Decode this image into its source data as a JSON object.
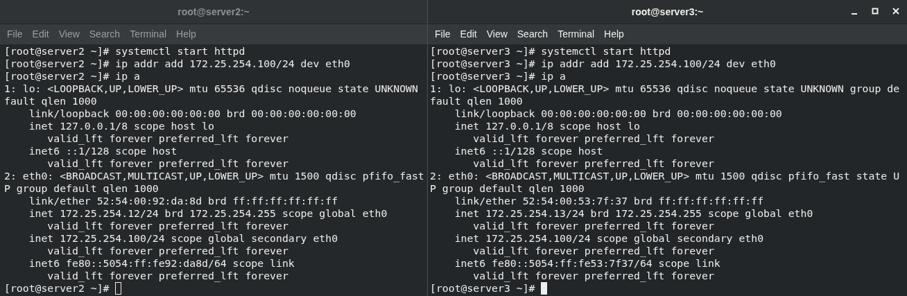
{
  "windows": [
    {
      "title": "root@server2:~",
      "active": false,
      "menu": [
        "File",
        "Edit",
        "View",
        "Search",
        "Terminal",
        "Help"
      ],
      "lines": [
        "[root@server2 ~]# systemctl start httpd",
        "[root@server2 ~]# ip addr add 172.25.254.100/24 dev eth0",
        "[root@server2 ~]# ip a",
        "1: lo: <LOOPBACK,UP,LOWER_UP> mtu 65536 qdisc noqueue state UNKNOWN",
        "fault qlen 1000",
        "    link/loopback 00:00:00:00:00:00 brd 00:00:00:00:00:00",
        "    inet 127.0.0.1/8 scope host lo",
        "       valid_lft forever preferred_lft forever",
        "    inet6 ::1/128 scope host",
        "       valid_lft forever preferred_lft forever",
        "2: eth0: <BROADCAST,MULTICAST,UP,LOWER_UP> mtu 1500 qdisc pfifo_fast",
        "P group default qlen 1000",
        "    link/ether 52:54:00:92:da:8d brd ff:ff:ff:ff:ff:ff",
        "    inet 172.25.254.12/24 brd 172.25.254.255 scope global eth0",
        "       valid_lft forever preferred_lft forever",
        "    inet 172.25.254.100/24 scope global secondary eth0",
        "       valid_lft forever preferred_lft forever",
        "    inet6 fe80::5054:ff:fe92:da8d/64 scope link",
        "       valid_lft forever preferred_lft forever"
      ],
      "prompt": "[root@server2 ~]# "
    },
    {
      "title": "root@server3:~",
      "active": true,
      "menu": [
        "File",
        "Edit",
        "View",
        "Search",
        "Terminal",
        "Help"
      ],
      "lines": [
        "[root@server3 ~]# systemctl start httpd",
        "[root@server3 ~]# ip addr add 172.25.254.100/24 dev eth0",
        "[root@server3 ~]# ip a",
        "1: lo: <LOOPBACK,UP,LOWER_UP> mtu 65536 qdisc noqueue state UNKNOWN group de",
        "fault qlen 1000",
        "    link/loopback 00:00:00:00:00:00 brd 00:00:00:00:00:00",
        "    inet 127.0.0.1/8 scope host lo",
        "       valid_lft forever preferred_lft forever",
        "    inet6 ::1/128 scope host",
        "       valid_lft forever preferred_lft forever",
        "2: eth0: <BROADCAST,MULTICAST,UP,LOWER_UP> mtu 1500 qdisc pfifo_fast state U",
        "P group default qlen 1000",
        "    link/ether 52:54:00:53:7f:37 brd ff:ff:ff:ff:ff:ff",
        "    inet 172.25.254.13/24 brd 172.25.254.255 scope global eth0",
        "       valid_lft forever preferred_lft forever",
        "    inet 172.25.254.100/24 scope global secondary eth0",
        "       valid_lft forever preferred_lft forever",
        "    inet6 fe80::5054:ff:fe53:7f37/64 scope link",
        "       valid_lft forever preferred_lft forever"
      ],
      "prompt": "[root@server3 ~]# "
    }
  ]
}
